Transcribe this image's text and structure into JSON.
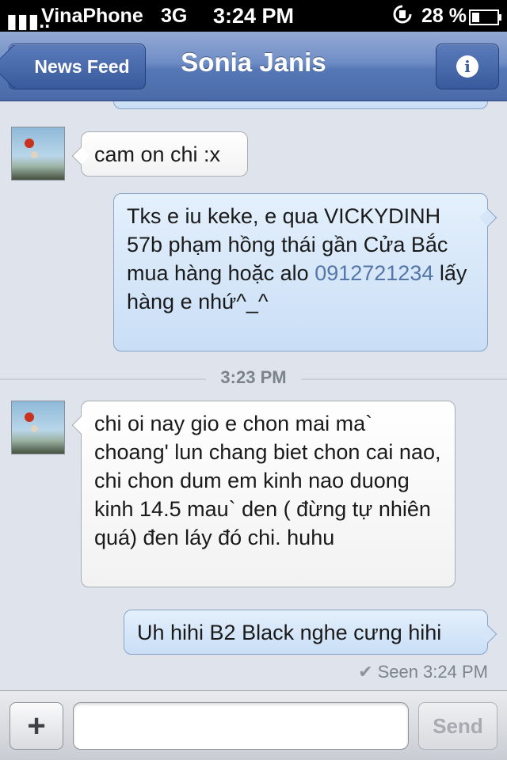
{
  "status_bar": {
    "signal": "▮▮▮..",
    "carrier": "VinaPhone",
    "network": "3G",
    "time": "3:24 PM",
    "rotation_icon": "rotation-lock-icon",
    "battery": "28 %"
  },
  "nav": {
    "back_label": "News Feed",
    "title": "Sonia Janis",
    "info_icon": "i"
  },
  "messages": [
    {
      "direction": "in",
      "text": "cam on chi :x"
    },
    {
      "direction": "out",
      "text_before": "Tks e iu keke, e qua VICKYDINH 57b phạm hồng thái gần Cửa Bắc mua hàng hoặc alo ",
      "link": "0912721234",
      "text_after": " lấy hàng e nhứ^_^"
    },
    {
      "direction": "in",
      "text": "chi oi nay gio e chon mai ma` choang' lun chang biet chon cai nao, chi chon dum em kinh nao duong kinh 14.5 mau` den ( đừng tự nhiên quá) đen láy đó chi. huhu"
    },
    {
      "direction": "out",
      "text": "Uh hihi B2 Black nghe cưng hihi"
    }
  ],
  "time_separator": "3:23 PM",
  "seen": "Seen 3:24 PM",
  "input_bar": {
    "plus_label": "+",
    "placeholder": "",
    "send_label": "Send"
  },
  "colors": {
    "nav_blue": "#4a6aa8",
    "outgoing_bubble": "#c9def6",
    "incoming_bubble": "#ffffff",
    "background": "#dfe4ec"
  }
}
